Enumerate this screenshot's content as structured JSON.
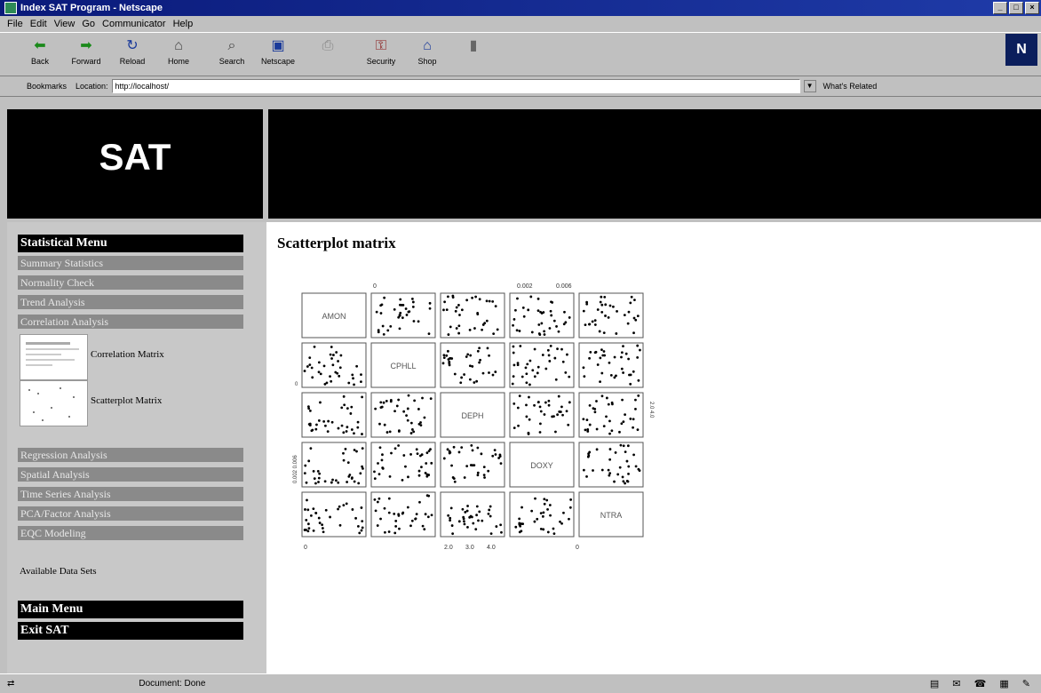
{
  "window": {
    "title": "Index SAT Program - Netscape"
  },
  "menu": [
    "File",
    "Edit",
    "View",
    "Go",
    "Communicator",
    "Help"
  ],
  "toolbar": [
    {
      "label": "Back",
      "icon": "back-arrow-icon",
      "glyph": "⬅"
    },
    {
      "label": "Forward",
      "icon": "forward-arrow-icon",
      "glyph": "➡"
    },
    {
      "label": "Reload",
      "icon": "reload-icon",
      "glyph": "↻"
    },
    {
      "label": "Home",
      "icon": "home-icon",
      "glyph": "⌂"
    },
    {
      "label": "Search",
      "icon": "search-icon",
      "glyph": "⌕"
    },
    {
      "label": "Netscape",
      "icon": "netscape-icon",
      "glyph": "▣"
    },
    {
      "label": "",
      "icon": "print-icon",
      "glyph": "⎙"
    },
    {
      "label": "Security",
      "icon": "security-icon",
      "glyph": "⚿"
    },
    {
      "label": "Shop",
      "icon": "shop-icon",
      "glyph": "⌂"
    },
    {
      "label": "",
      "icon": "stop-icon",
      "glyph": "▮"
    }
  ],
  "location": {
    "bookmarks": "Bookmarks",
    "label": "Location:",
    "url": "http://localhost/",
    "related": "What's Related"
  },
  "banner": {
    "title": "SAT"
  },
  "sidebar": {
    "heading": "Statistical Menu",
    "items_top": [
      "Summary Statistics",
      "Normality Check",
      "Trend Analysis",
      "Correlation Analysis"
    ],
    "sub": [
      "Correlation Matrix",
      "Scatterplot Matrix"
    ],
    "items_bottom": [
      "Regression Analysis",
      "Spatial Analysis",
      "Time Series Analysis",
      "PCA/Factor Analysis",
      "EQC Modeling"
    ],
    "available": "Available Data Sets",
    "main_menu": "Main Menu",
    "exit": "Exit SAT"
  },
  "page": {
    "title": "Scatterplot matrix"
  },
  "chart_data": {
    "type": "scatter",
    "variables": [
      "AMON",
      "CPHLL",
      "DEPH",
      "DOXY",
      "NTRA"
    ],
    "top_ticks": [
      "0",
      "0.002",
      "0.006"
    ],
    "bottom_ticks": [
      "0",
      "2.0",
      "3.0",
      "4.0",
      "0"
    ],
    "left_ticks": [
      "0",
      "0.002  0.006"
    ],
    "right_ticks": [
      "2.0  4.0"
    ]
  },
  "status": {
    "text": "Document: Done"
  }
}
